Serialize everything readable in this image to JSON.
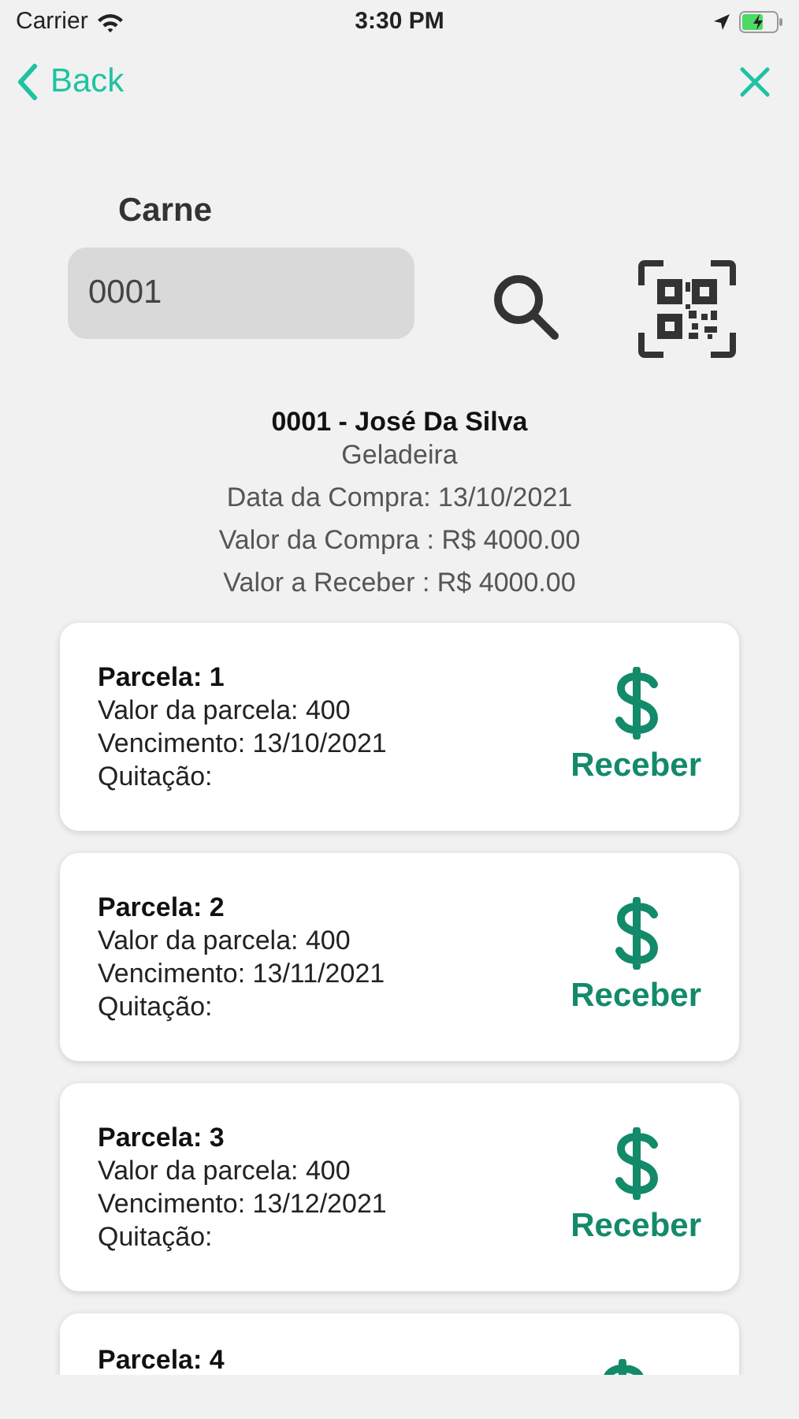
{
  "status_bar": {
    "carrier": "Carrier",
    "time": "3:30 PM"
  },
  "nav": {
    "back": "Back"
  },
  "search": {
    "label": "Carne",
    "value": "0001"
  },
  "summary": {
    "title": "0001 - José Da Silva",
    "product": "Geladeira",
    "lines": [
      "Data da Compra: 13/10/2021",
      "Valor da Compra : R$ 4000.00",
      "Valor a Receber : R$ 4000.00"
    ]
  },
  "installments": [
    {
      "title": "Parcela: 1",
      "lines": [
        "Valor da parcela: 400",
        "Vencimento: 13/10/2021",
        "Quitação:"
      ],
      "action": "Receber"
    },
    {
      "title": "Parcela: 2",
      "lines": [
        "Valor da parcela: 400",
        "Vencimento: 13/11/2021",
        "Quitação:"
      ],
      "action": "Receber"
    },
    {
      "title": "Parcela: 3",
      "lines": [
        "Valor da parcela: 400",
        "Vencimento: 13/12/2021",
        "Quitação:"
      ],
      "action": "Receber"
    },
    {
      "title": "Parcela: 4"
    }
  ]
}
